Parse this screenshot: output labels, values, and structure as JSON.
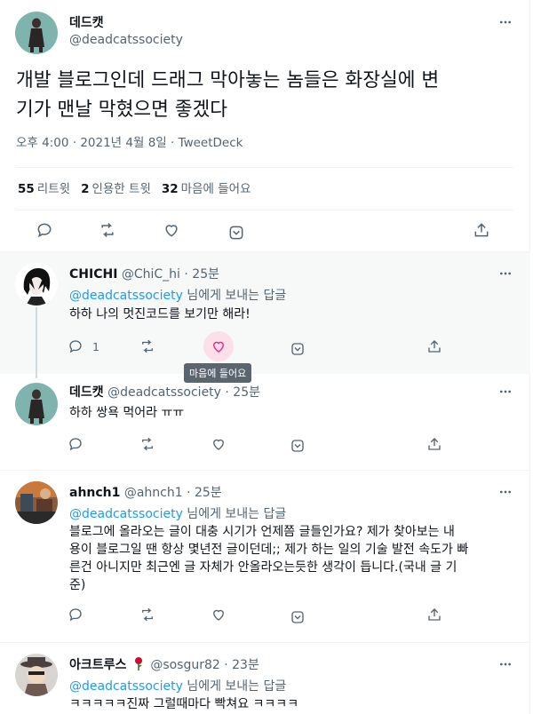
{
  "main_tweet": {
    "name": "데드캣",
    "handle": "@deadcatssociety",
    "text_line1": "개발 블로그인데 드래그 막아놓는 놈들은 화장실에 변",
    "text_line2": "기가 맨날 막혔으면 좋겠다",
    "meta": "오후 4:00 · 2021년 4월 8일 · TweetDeck",
    "stats": {
      "retweets_count": "55",
      "retweets_label": "리트윗",
      "quotes_count": "2",
      "quotes_label": "인용한 트윗",
      "likes_count": "32",
      "likes_label": "마음에 들어요"
    }
  },
  "replies": [
    {
      "name": "CHICHI",
      "handle_time": "@ChiC_hi · 25분",
      "to_link": "@deadcatssociety",
      "to_suffix": " 님에게 보내는 답글",
      "text": "하하 나의 멋진코드를 보기만 해라!",
      "reply_count": "1",
      "tooltip": "마음에 들어요"
    },
    {
      "name": "데드캣",
      "handle_time": "@deadcatssociety · 25분",
      "text": "하하 쌍욕 먹어라 ㅠㅠ"
    },
    {
      "name": "ahnch1",
      "handle_time": "@ahnch1 · 25분",
      "to_link": "@deadcatssociety",
      "to_suffix": " 님에게 보내는 답글",
      "text_lines": [
        "블로그에 올라오는 글이 대충 시기가 언제쯤 글들인가요? 제가 찾아보는 내",
        "용이 블로그일 땐 항상 몇년전 글이던데;; 제가 하는 일의 기술 발전 속도가 빠",
        "른건 아니지만 최근엔 글 자체가 안올라오는듯한 생각이 듭니다.(국내 글 기",
        "준)"
      ]
    },
    {
      "name": "아크트루스",
      "handle_time": "@sosgur82 · 23분",
      "to_link": "@deadcatssociety",
      "to_suffix": " 님에게 보내는 답글",
      "text": "ㅋㅋㅋㅋㅋ진짜 그럴때마다 빡쳐요 ㅋㅋㅋㅋ"
    }
  ],
  "icons": [
    "more-icon",
    "reply-icon",
    "retweet-icon",
    "like-icon",
    "bookmark-icon",
    "share-icon",
    "rose-icon"
  ],
  "colors": {
    "link": "#1d9bf0",
    "secondary_text": "#536471",
    "like_highlight": "#f91880"
  }
}
